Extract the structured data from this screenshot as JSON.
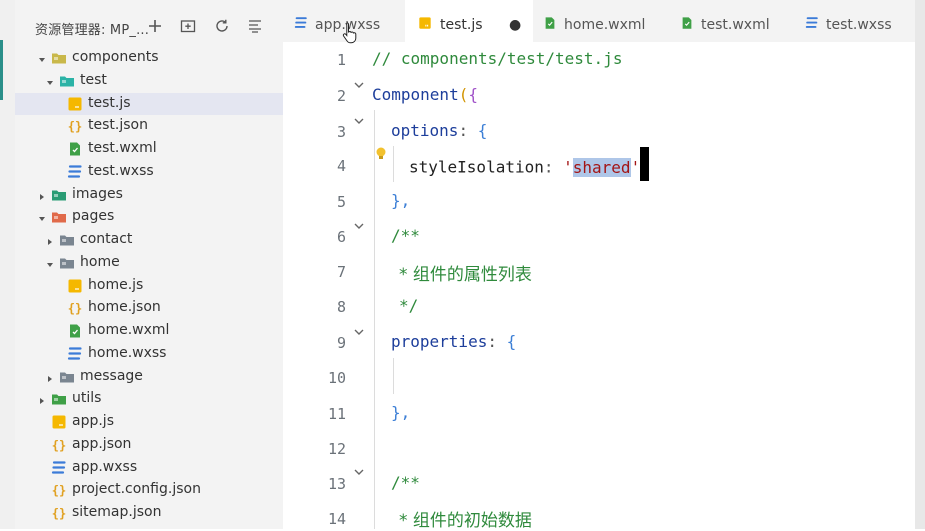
{
  "explorer": {
    "title": "资源管理器: MP_..."
  },
  "tree": [
    {
      "label": "components",
      "depth": 1,
      "kind": "folder",
      "expanded": true,
      "color": "#c9b84a"
    },
    {
      "label": "test",
      "depth": 2,
      "kind": "folder",
      "expanded": true,
      "color": "#2bb3a6"
    },
    {
      "label": "test.js",
      "depth": 3,
      "kind": "js",
      "active": true
    },
    {
      "label": "test.json",
      "depth": 3,
      "kind": "json"
    },
    {
      "label": "test.wxml",
      "depth": 3,
      "kind": "wxml"
    },
    {
      "label": "test.wxss",
      "depth": 3,
      "kind": "wxss"
    },
    {
      "label": "images",
      "depth": 1,
      "kind": "folder",
      "expanded": false,
      "color": "#2a9c74"
    },
    {
      "label": "pages",
      "depth": 1,
      "kind": "folder",
      "expanded": true,
      "color": "#e06a4a"
    },
    {
      "label": "contact",
      "depth": 2,
      "kind": "folder",
      "expanded": false,
      "color": "#7a8590"
    },
    {
      "label": "home",
      "depth": 2,
      "kind": "folder",
      "expanded": true,
      "color": "#7a8590"
    },
    {
      "label": "home.js",
      "depth": 3,
      "kind": "js"
    },
    {
      "label": "home.json",
      "depth": 3,
      "kind": "json"
    },
    {
      "label": "home.wxml",
      "depth": 3,
      "kind": "wxml"
    },
    {
      "label": "home.wxss",
      "depth": 3,
      "kind": "wxss"
    },
    {
      "label": "message",
      "depth": 2,
      "kind": "folder",
      "expanded": false,
      "color": "#7a8590"
    },
    {
      "label": "utils",
      "depth": 1,
      "kind": "folder",
      "expanded": false,
      "color": "#3fa047"
    },
    {
      "label": "app.js",
      "depth": 1,
      "kind": "js"
    },
    {
      "label": "app.json",
      "depth": 1,
      "kind": "json"
    },
    {
      "label": "app.wxss",
      "depth": 1,
      "kind": "wxss"
    },
    {
      "label": "project.config.json",
      "depth": 1,
      "kind": "json"
    },
    {
      "label": "sitemap.json",
      "depth": 1,
      "kind": "json"
    }
  ],
  "tabs": [
    {
      "label": "app.wxss",
      "kind": "wxss"
    },
    {
      "label": "test.js",
      "kind": "js",
      "active": true,
      "dirty": true,
      "dirty_mark": "●"
    },
    {
      "label": "home.wxml",
      "kind": "wxml"
    },
    {
      "label": "test.wxml",
      "kind": "wxml"
    },
    {
      "label": "test.wxss",
      "kind": "wxss"
    }
  ],
  "editor": {
    "line_numbers": [
      "1",
      "2",
      "3",
      "4",
      "5",
      "6",
      "7",
      "8",
      "9",
      "10",
      "11",
      "12",
      "13",
      "14"
    ],
    "line1": "// components/test/test.js",
    "line2_kw": "Component",
    "line2_paren": "(",
    "line2_brace": "{",
    "line3_key": "options",
    "line3_colon": ": ",
    "line3_brace": "{",
    "line4_key": "styleIsolation",
    "line4_colon": ": ",
    "line4_q1": "'",
    "line4_val": "shared",
    "line4_q2": "'",
    "line5": "},",
    "line6": "/**",
    "line7": "* 组件的属性列表",
    "line8": "*/",
    "line9_key": "properties",
    "line9_colon": ": ",
    "line9_brace": "{",
    "line11": "},",
    "line13": "/**",
    "line14": "* 组件的初始数据"
  },
  "icons": {
    "new_file": "new-file-icon",
    "new_folder": "new-folder-icon",
    "refresh": "refresh-icon",
    "collapse": "collapse-all-icon"
  },
  "colors": {
    "js": "#f5b800",
    "json": "#e0a020",
    "wxml": "#3fa047",
    "wxss": "#3b7bd8",
    "comment": "#2f8a3c",
    "selection": "#aec6e8"
  }
}
